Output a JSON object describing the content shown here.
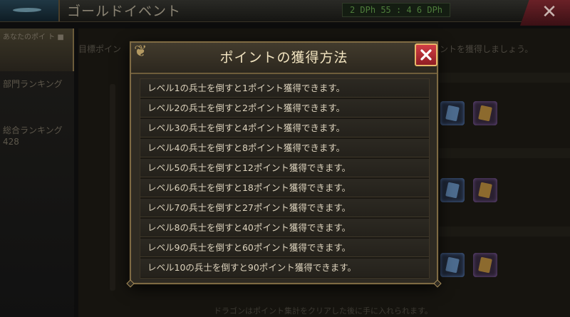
{
  "background": {
    "title": "ゴールドイベント",
    "timer": "2 DPh 55 : 4 6 DPh",
    "sidebar_active": "あなたのポイ ト ■",
    "sidebar_items": [
      "部門ランキング",
      "総合ランキング 428"
    ],
    "hint_left": "目標ポイン",
    "hint_right": "ントを獲得しましょう。",
    "footer": "ドラゴンはポイント集計をクリアした後に手に入れられます。"
  },
  "modal": {
    "title": "ポイントの獲得方法",
    "rows": [
      "レベル1の兵士を倒すと1ポイント獲得できます。",
      "レベル2の兵士を倒すと2ポイント獲得できます。",
      "レベル3の兵士を倒すと4ポイント獲得できます。",
      "レベル4の兵士を倒すと8ポイント獲得できます。",
      "レベル5の兵士を倒すと12ポイント獲得できます。",
      "レベル6の兵士を倒すと18ポイント獲得できます。",
      "レベル7の兵士を倒すと27ポイント獲得できます。",
      "レベル8の兵士を倒すと40ポイント獲得できます。",
      "レベル9の兵士を倒すと60ポイント獲得できます。",
      "レベル10の兵士を倒すと90ポイント獲得できます。"
    ]
  },
  "colors": {
    "modal_border": "#7e6a43",
    "title_text": "#f2e4c0",
    "close_button": "#c9323a",
    "row_text": "#ddd3bd"
  },
  "icons": {
    "close": "close-x-icon",
    "ornament": "scroll-ornament-icon"
  }
}
